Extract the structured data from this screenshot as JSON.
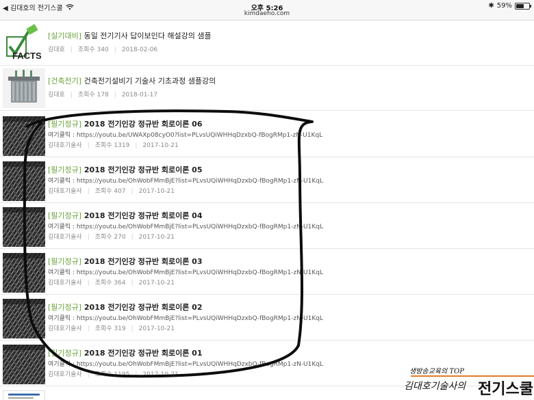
{
  "statusbar": {
    "back_app": "◀ 김대호의 전기스쿨",
    "time": "오후 5:26",
    "url": "kimdaeho.com",
    "battery": "59%",
    "battery_level": 0.59
  },
  "posts": [
    {
      "category": "[실기대비]",
      "title": " 동일 전기기사 답이보인다 해설강의 샘플",
      "excerpt": "",
      "author": "김대호",
      "views": "조회수 340",
      "date": "2018-02-06",
      "thumb": "facts-logo"
    },
    {
      "category": "[건축전기]",
      "title": " 건축전기설비기 기술사 기초과정 샘플강의",
      "excerpt": "",
      "author": "김대호",
      "views": "조회수 178",
      "date": "2018-01-17",
      "thumb": "transformer-photo"
    },
    {
      "category": "[필기정규]",
      "title": " 2018 전기인강 정규반 회로이론 06",
      "excerpt": "여기클릭 : https://youtu.be/UWAXp08cyO0?list=PLvsUQiWHHqDzxbQ-fBogRMp1-zN-U1KqL",
      "author": "김대호기술사",
      "views": "조회수 1319",
      "date": "2017-10-21",
      "thumb": "dark-pattern"
    },
    {
      "category": "[필기정규]",
      "title": " 2018 전기인강 정규반 회로이론 05",
      "excerpt": " 여기클릭 : https://youtu.be/OhWobFMmBjE?list=PLvsUQiWHHqDzxbQ-fBogRMp1-zN-U1KqL",
      "author": "김대호기술사",
      "views": "조회수 407",
      "date": "2017-10-21",
      "thumb": "dark-pattern"
    },
    {
      "category": "[필기정규]",
      "title": " 2018 전기인강 정규반 회로이론 04",
      "excerpt": "여기클릭 : https://youtu.be/OhWobFMmBjE?list=PLvsUQiWHHqDzxbQ-fBogRMp1-zN-U1KqL",
      "author": "김대호기술사",
      "views": "조회수 270",
      "date": "2017-10-21",
      "thumb": "dark-pattern"
    },
    {
      "category": "[필기정규]",
      "title": " 2018 전기인강 정규반 회로이론 03",
      "excerpt": "여기클릭 : https://youtu.be/OhWobFMmBjE?list=PLvsUQiWHHqDzxbQ-fBogRMp1-zN-U1KqL",
      "author": "김대호기술사",
      "views": "조회수 364",
      "date": "2017-10-21",
      "thumb": "dark-pattern"
    },
    {
      "category": "[필기정규]",
      "title": " 2018 전기인강 정규반 회로이론 02",
      "excerpt": "여기클릭 : https://youtu.be/OhWobFMmBjE?list=PLvsUQiWHHqDzxbQ-fBogRMp1-zN-U1KqL",
      "author": "김대호기술사",
      "views": "조회수 319",
      "date": "2017-10-21",
      "thumb": "dark-pattern"
    },
    {
      "category": "[필기정규]",
      "title": " 2018 전기인강 정규반 회로이론 01",
      "excerpt": "여기클릭 : https://youtu.be/OhWobFMmBjE?list=PLvsUQiWHHqDzxbQ-fBogRMp1-zN-U1KqL",
      "author": "김대호기술사",
      "views": "조회수 1195",
      "date": "2017-10-21",
      "thumb": "dark-pattern"
    }
  ],
  "watermark": {
    "tagline": "생방송교육의 TOP",
    "name": "김대호기술사의",
    "brand": "전기스쿨"
  },
  "colors": {
    "category": "#6aa33a",
    "watermark_rule": "#e07b2a"
  }
}
